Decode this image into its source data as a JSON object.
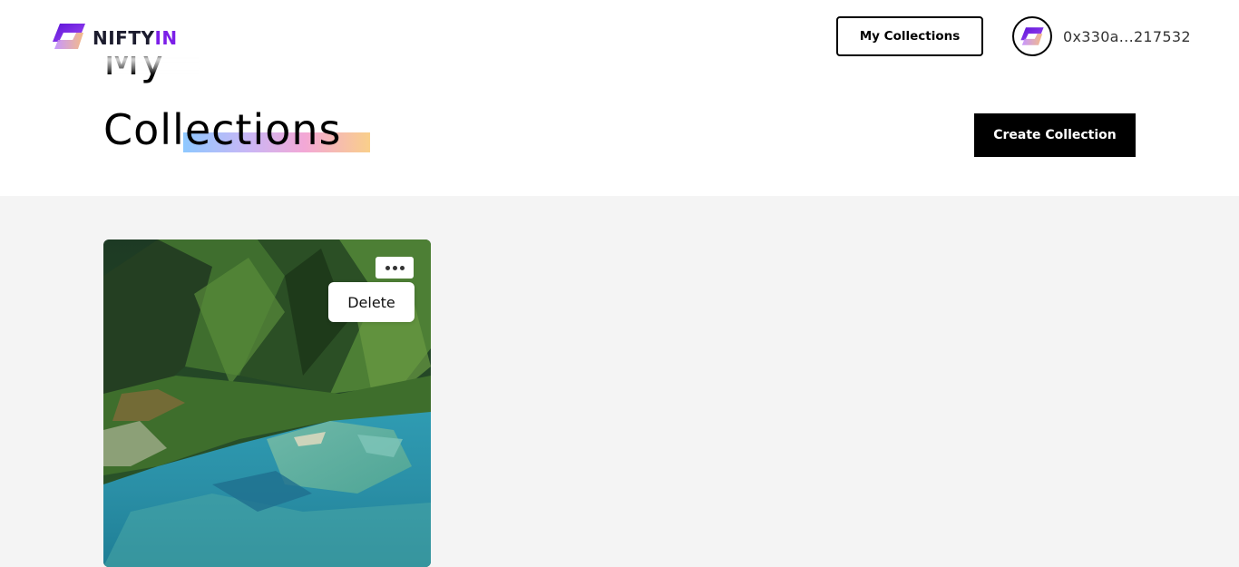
{
  "header": {
    "logo_text_main": "NIFTY",
    "logo_text_accent": "IN",
    "nav_my_collections": "My Collections",
    "wallet_address": "0x330a...217532"
  },
  "page": {
    "title_line1": "My",
    "title_line2": "Collections",
    "create_button": "Create Collection"
  },
  "collections": [
    {
      "image": "aerial-island-lagoon-photo",
      "menu_items": [
        "Delete"
      ]
    }
  ],
  "colors": {
    "brand_purple": "#7c1fe8",
    "brand_violet": "#a15cf0",
    "content_background": "#f4f4f4",
    "title_highlight": [
      "#8ec8ff",
      "#c9b6f5",
      "#f3a8d6",
      "#f9cf8a"
    ]
  },
  "icons": {
    "logo": "niftyin-logo-icon",
    "avatar": "niftyin-avatar-icon",
    "more": "more-dots-icon"
  }
}
